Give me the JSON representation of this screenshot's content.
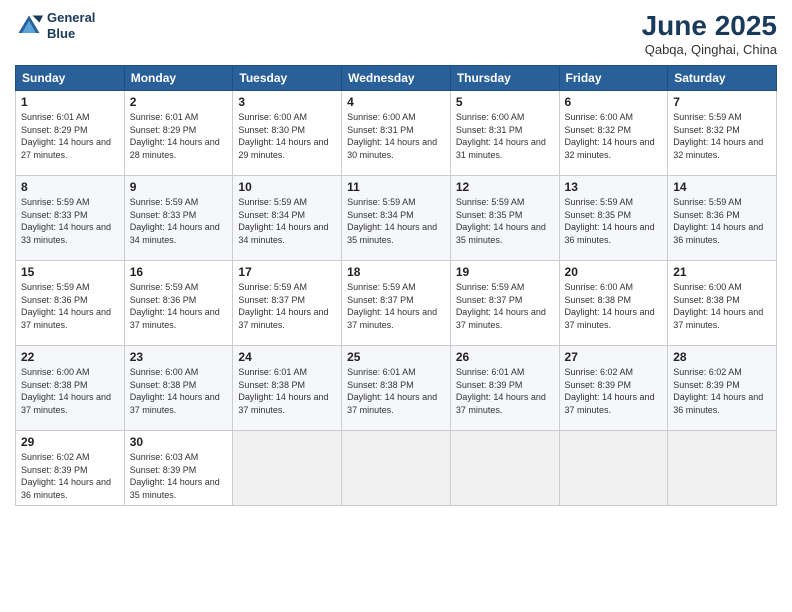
{
  "header": {
    "logo_line1": "General",
    "logo_line2": "Blue",
    "month": "June 2025",
    "location": "Qabqa, Qinghai, China"
  },
  "days_of_week": [
    "Sunday",
    "Monday",
    "Tuesday",
    "Wednesday",
    "Thursday",
    "Friday",
    "Saturday"
  ],
  "weeks": [
    [
      {
        "day": "1",
        "sunrise": "6:01 AM",
        "sunset": "8:29 PM",
        "daylight": "14 hours and 27 minutes."
      },
      {
        "day": "2",
        "sunrise": "6:01 AM",
        "sunset": "8:29 PM",
        "daylight": "14 hours and 28 minutes."
      },
      {
        "day": "3",
        "sunrise": "6:00 AM",
        "sunset": "8:30 PM",
        "daylight": "14 hours and 29 minutes."
      },
      {
        "day": "4",
        "sunrise": "6:00 AM",
        "sunset": "8:31 PM",
        "daylight": "14 hours and 30 minutes."
      },
      {
        "day": "5",
        "sunrise": "6:00 AM",
        "sunset": "8:31 PM",
        "daylight": "14 hours and 31 minutes."
      },
      {
        "day": "6",
        "sunrise": "6:00 AM",
        "sunset": "8:32 PM",
        "daylight": "14 hours and 32 minutes."
      },
      {
        "day": "7",
        "sunrise": "5:59 AM",
        "sunset": "8:32 PM",
        "daylight": "14 hours and 32 minutes."
      }
    ],
    [
      {
        "day": "8",
        "sunrise": "5:59 AM",
        "sunset": "8:33 PM",
        "daylight": "14 hours and 33 minutes."
      },
      {
        "day": "9",
        "sunrise": "5:59 AM",
        "sunset": "8:33 PM",
        "daylight": "14 hours and 34 minutes."
      },
      {
        "day": "10",
        "sunrise": "5:59 AM",
        "sunset": "8:34 PM",
        "daylight": "14 hours and 34 minutes."
      },
      {
        "day": "11",
        "sunrise": "5:59 AM",
        "sunset": "8:34 PM",
        "daylight": "14 hours and 35 minutes."
      },
      {
        "day": "12",
        "sunrise": "5:59 AM",
        "sunset": "8:35 PM",
        "daylight": "14 hours and 35 minutes."
      },
      {
        "day": "13",
        "sunrise": "5:59 AM",
        "sunset": "8:35 PM",
        "daylight": "14 hours and 36 minutes."
      },
      {
        "day": "14",
        "sunrise": "5:59 AM",
        "sunset": "8:36 PM",
        "daylight": "14 hours and 36 minutes."
      }
    ],
    [
      {
        "day": "15",
        "sunrise": "5:59 AM",
        "sunset": "8:36 PM",
        "daylight": "14 hours and 37 minutes."
      },
      {
        "day": "16",
        "sunrise": "5:59 AM",
        "sunset": "8:36 PM",
        "daylight": "14 hours and 37 minutes."
      },
      {
        "day": "17",
        "sunrise": "5:59 AM",
        "sunset": "8:37 PM",
        "daylight": "14 hours and 37 minutes."
      },
      {
        "day": "18",
        "sunrise": "5:59 AM",
        "sunset": "8:37 PM",
        "daylight": "14 hours and 37 minutes."
      },
      {
        "day": "19",
        "sunrise": "5:59 AM",
        "sunset": "8:37 PM",
        "daylight": "14 hours and 37 minutes."
      },
      {
        "day": "20",
        "sunrise": "6:00 AM",
        "sunset": "8:38 PM",
        "daylight": "14 hours and 37 minutes."
      },
      {
        "day": "21",
        "sunrise": "6:00 AM",
        "sunset": "8:38 PM",
        "daylight": "14 hours and 37 minutes."
      }
    ],
    [
      {
        "day": "22",
        "sunrise": "6:00 AM",
        "sunset": "8:38 PM",
        "daylight": "14 hours and 37 minutes."
      },
      {
        "day": "23",
        "sunrise": "6:00 AM",
        "sunset": "8:38 PM",
        "daylight": "14 hours and 37 minutes."
      },
      {
        "day": "24",
        "sunrise": "6:01 AM",
        "sunset": "8:38 PM",
        "daylight": "14 hours and 37 minutes."
      },
      {
        "day": "25",
        "sunrise": "6:01 AM",
        "sunset": "8:38 PM",
        "daylight": "14 hours and 37 minutes."
      },
      {
        "day": "26",
        "sunrise": "6:01 AM",
        "sunset": "8:39 PM",
        "daylight": "14 hours and 37 minutes."
      },
      {
        "day": "27",
        "sunrise": "6:02 AM",
        "sunset": "8:39 PM",
        "daylight": "14 hours and 37 minutes."
      },
      {
        "day": "28",
        "sunrise": "6:02 AM",
        "sunset": "8:39 PM",
        "daylight": "14 hours and 36 minutes."
      }
    ],
    [
      {
        "day": "29",
        "sunrise": "6:02 AM",
        "sunset": "8:39 PM",
        "daylight": "14 hours and 36 minutes."
      },
      {
        "day": "30",
        "sunrise": "6:03 AM",
        "sunset": "8:39 PM",
        "daylight": "14 hours and 35 minutes."
      },
      null,
      null,
      null,
      null,
      null
    ]
  ]
}
